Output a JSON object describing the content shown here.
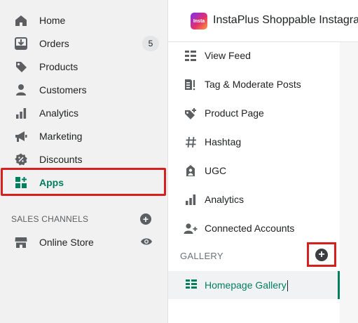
{
  "admin_nav": {
    "items": [
      {
        "label": "Home",
        "icon": "home-icon"
      },
      {
        "label": "Orders",
        "icon": "orders-icon",
        "badge": "5"
      },
      {
        "label": "Products",
        "icon": "tag-icon"
      },
      {
        "label": "Customers",
        "icon": "person-icon"
      },
      {
        "label": "Analytics",
        "icon": "bar-chart-icon"
      },
      {
        "label": "Marketing",
        "icon": "megaphone-icon"
      },
      {
        "label": "Discounts",
        "icon": "discount-icon"
      },
      {
        "label": "Apps",
        "icon": "apps-icon",
        "active": true
      }
    ],
    "sales_channels_heading": "SALES CHANNELS",
    "channels": [
      {
        "label": "Online Store",
        "icon": "store-icon"
      }
    ]
  },
  "app_header": {
    "logo_text": "Insta",
    "title": "InstaPlus Shoppable Instagram"
  },
  "app_nav": {
    "items": [
      {
        "label": "View Feed",
        "icon": "feed-icon"
      },
      {
        "label": "Tag & Moderate Posts",
        "icon": "tag-moderate-icon"
      },
      {
        "label": "Product Page",
        "icon": "product-tag-icon"
      },
      {
        "label": "Hashtag",
        "icon": "hashtag-icon"
      },
      {
        "label": "UGC",
        "icon": "ugc-icon"
      },
      {
        "label": "Analytics",
        "icon": "bar-chart-icon"
      },
      {
        "label": "Connected Accounts",
        "icon": "add-person-icon"
      }
    ],
    "gallery_heading": "GALLERY",
    "gallery_items": [
      {
        "label": "Homepage Gallery",
        "icon": "gallery-grid-icon",
        "selected": true
      }
    ]
  },
  "colors": {
    "accent_green": "#007f5f",
    "highlight_red": "#d61f1f",
    "icon_gray": "#5c5f62"
  }
}
